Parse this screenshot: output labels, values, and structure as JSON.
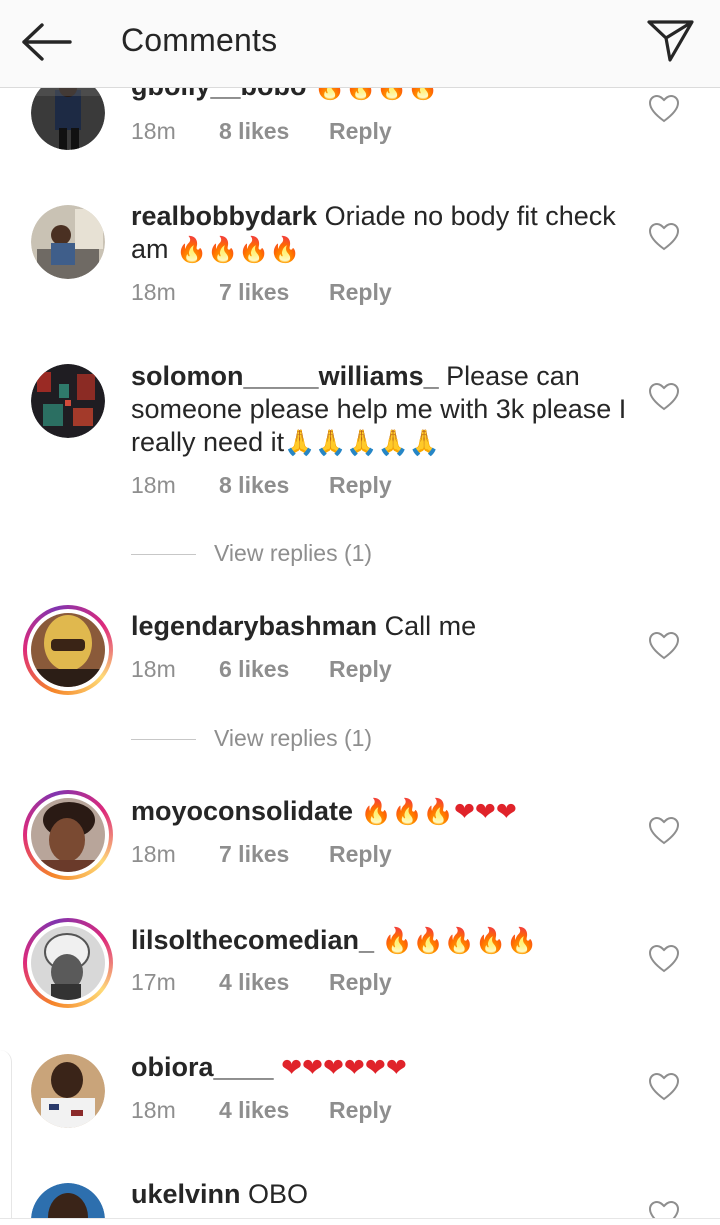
{
  "header": {
    "title": "Comments",
    "back": "back-arrow-icon",
    "share": "send-icon"
  },
  "comments": [
    {
      "username": "gbolly__bobo",
      "text": "",
      "emoji": "🔥🔥🔥🔥",
      "time": "18m",
      "likes": "8 likes",
      "reply": "Reply"
    },
    {
      "username": "realbobbydark",
      "text": "Oriade no body fit check am",
      "emoji": "🔥🔥🔥🔥",
      "time": "18m",
      "likes": "7 likes",
      "reply": "Reply"
    },
    {
      "username": "solomon_____williams_",
      "text": "Please can someone please help me with 3k please I really need it",
      "emoji": "🙏🙏🙏🙏🙏",
      "time": "18m",
      "likes": "8 likes",
      "reply": "Reply",
      "view_replies": "View replies (1)"
    },
    {
      "username": "legendarybashman",
      "text": "Call me",
      "emoji": "",
      "time": "18m",
      "likes": "6 likes",
      "reply": "Reply",
      "view_replies": "View replies (1)"
    },
    {
      "username": "moyoconsolidate",
      "text": "",
      "emoji": "🔥🔥🔥❤❤❤",
      "time": "18m",
      "likes": "7 likes",
      "reply": "Reply"
    },
    {
      "username": "lilsolthecomedian_",
      "text": "",
      "emoji": "🔥🔥🔥🔥🔥",
      "time": "17m",
      "likes": "4 likes",
      "reply": "Reply"
    },
    {
      "username": "obiora____",
      "text": "",
      "emoji": "❤❤❤❤❤❤",
      "time": "18m",
      "likes": "4 likes",
      "reply": "Reply"
    },
    {
      "username": "ukelvinn",
      "text": "OBO",
      "emoji": "",
      "time": "",
      "likes": "",
      "reply": ""
    }
  ],
  "colors": {
    "fire": "#f07d11",
    "heart": "#e0232a",
    "pray": "#3b9ae1",
    "meta": "#8e8e8e",
    "text": "#262626"
  }
}
